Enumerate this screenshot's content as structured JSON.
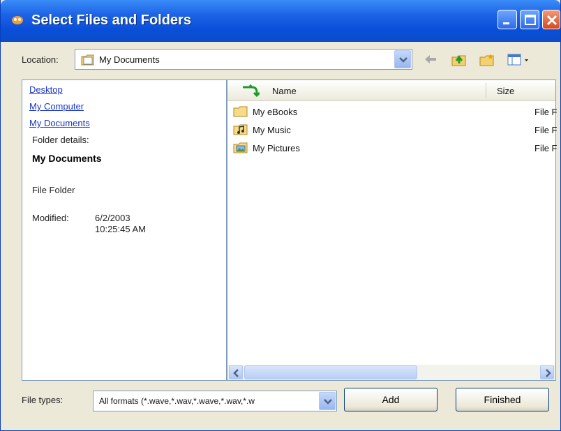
{
  "window": {
    "title": "Select Files and Folders"
  },
  "location": {
    "label": "Location:",
    "value": "My Documents"
  },
  "left_pane": {
    "links": [
      "Desktop",
      "My Computer",
      "My Documents"
    ],
    "details_label": "Folder details:",
    "folder_name": "My Documents",
    "folder_type": "File Folder",
    "modified_label": "Modified:",
    "modified_date": "6/2/2003",
    "modified_time": "10:25:45 AM"
  },
  "file_list": {
    "columns": [
      "Name",
      "Size"
    ],
    "rows": [
      {
        "name": "My eBooks",
        "type": "File F",
        "icon": "folder-icon"
      },
      {
        "name": "My Music",
        "type": "File F",
        "icon": "music-folder-icon"
      },
      {
        "name": "My Pictures",
        "type": "File F",
        "icon": "pictures-folder-icon"
      }
    ]
  },
  "file_types": {
    "label": "File types:",
    "value": "All formats  (*.wave,*.wav,*.wave,*.wav,*.w"
  },
  "buttons": {
    "add": "Add",
    "finished": "Finished"
  },
  "colors": {
    "titlebar": "#0a4fd9",
    "link": "#1a37c8",
    "window_bg": "#ece9d8"
  }
}
